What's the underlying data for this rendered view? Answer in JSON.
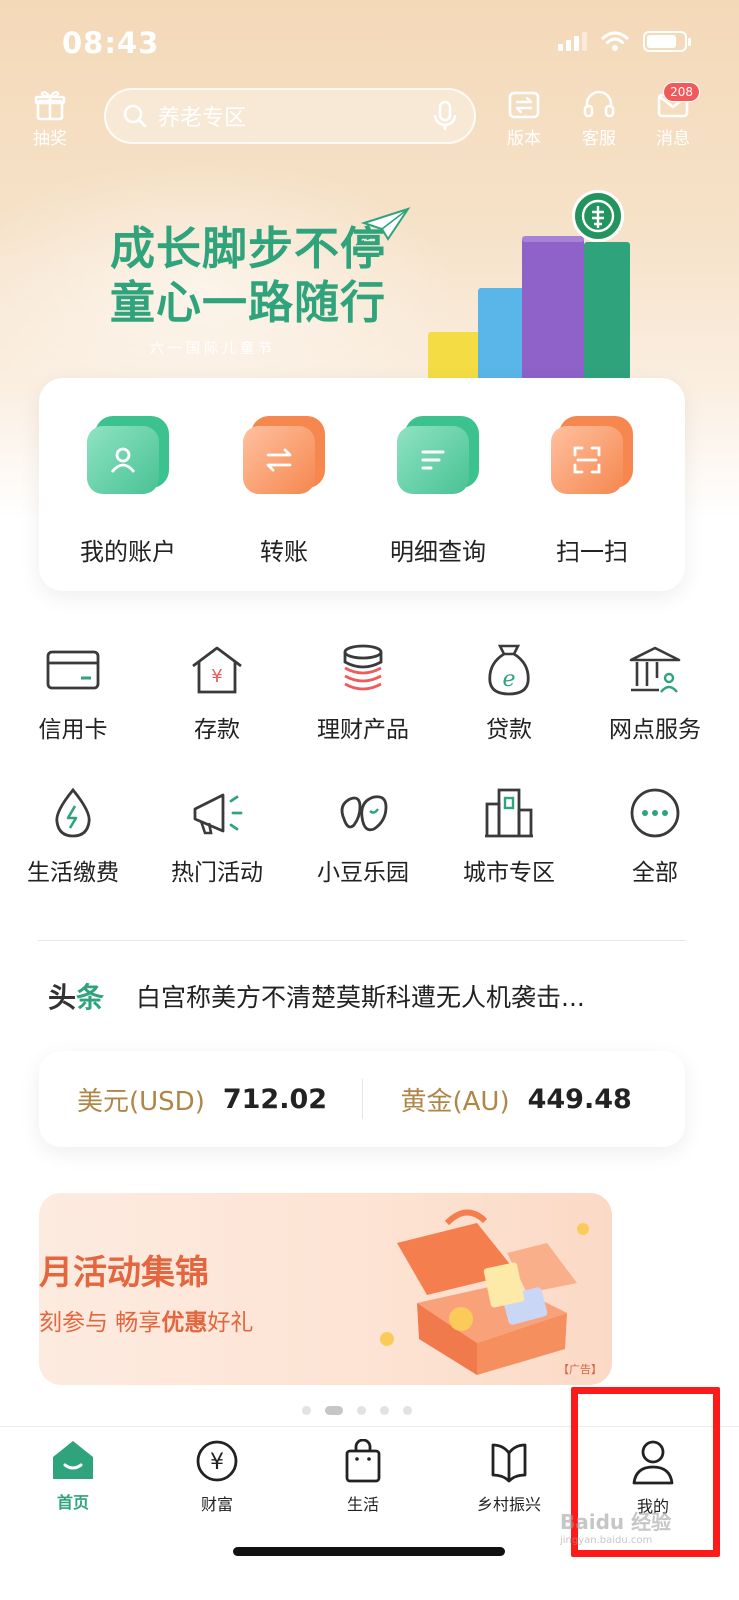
{
  "status_bar": {
    "time": "08:43"
  },
  "top_bar": {
    "lottery_label": "抽奖",
    "search_placeholder": "养老专区",
    "version_label": "版本",
    "service_label": "客服",
    "messages_label": "消息",
    "messages_badge": "208"
  },
  "banner": {
    "line1": "成长脚步不停",
    "line2": "童心一路随行",
    "line3": "六一国际儿童节"
  },
  "quick_actions": [
    {
      "label": "我的账户",
      "icon": "account-icon"
    },
    {
      "label": "转账",
      "icon": "transfer-icon"
    },
    {
      "label": "明细查询",
      "icon": "details-icon"
    },
    {
      "label": "扫一扫",
      "icon": "scan-icon"
    }
  ],
  "services": [
    {
      "label": "信用卡",
      "icon": "credit-card-icon"
    },
    {
      "label": "存款",
      "icon": "deposit-icon"
    },
    {
      "label": "理财产品",
      "icon": "wealth-products-icon"
    },
    {
      "label": "贷款",
      "icon": "loan-icon"
    },
    {
      "label": "网点服务",
      "icon": "branch-service-icon"
    },
    {
      "label": "生活缴费",
      "icon": "utility-payment-icon"
    },
    {
      "label": "热门活动",
      "icon": "hot-activity-icon"
    },
    {
      "label": "小豆乐园",
      "icon": "bean-park-icon"
    },
    {
      "label": "城市专区",
      "icon": "city-zone-icon"
    },
    {
      "label": "全部",
      "icon": "more-icon"
    }
  ],
  "news": {
    "tag_a": "头",
    "tag_b": "条",
    "headline": "白宫称美方不清楚莫斯科遭无人机袭击..."
  },
  "rates": [
    {
      "name": "美元(USD)",
      "value": "712.02"
    },
    {
      "name": "黄金(AU)",
      "value": "449.48"
    }
  ],
  "promo": {
    "title": "月活动集锦",
    "subtitle_a": "刻参与  畅享",
    "subtitle_b": "优惠",
    "subtitle_c": "好礼",
    "ad_label": "【广告】"
  },
  "carousel": {
    "count": 5,
    "active_index": 1
  },
  "tabs": [
    {
      "label": "首页",
      "icon": "home-icon",
      "active": true
    },
    {
      "label": "财富",
      "icon": "wealth-icon",
      "active": false
    },
    {
      "label": "生活",
      "icon": "life-bag-icon",
      "active": false
    },
    {
      "label": "乡村振兴",
      "icon": "rural-book-icon",
      "active": false
    },
    {
      "label": "我的",
      "icon": "profile-icon",
      "active": false
    }
  ],
  "watermark": {
    "text": "Baidu 经验",
    "url": "jingyan.baidu.com"
  },
  "colors": {
    "accent": "#2fa37b",
    "orange": "#f5874f",
    "gold": "#b08648",
    "highlight": "#ff1a1a"
  }
}
